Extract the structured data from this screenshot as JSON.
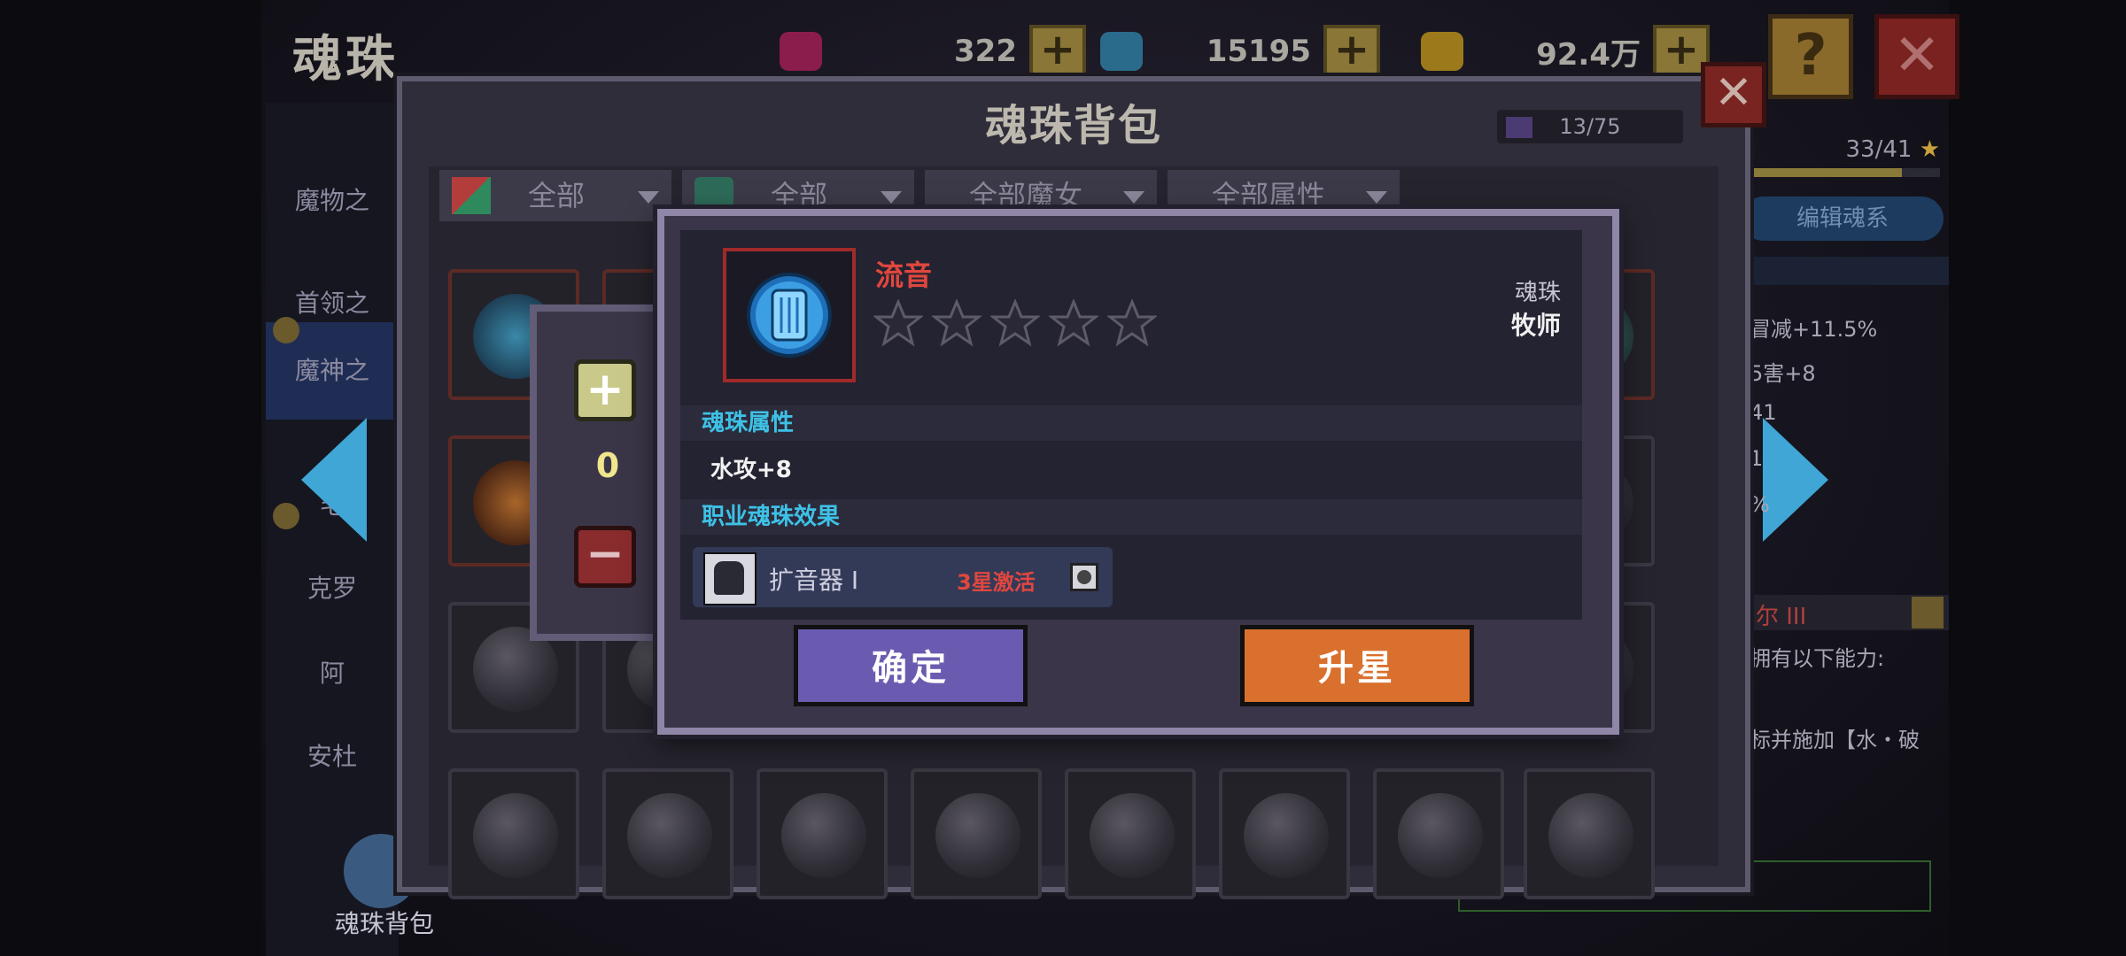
{
  "page_title": "魂珠",
  "currencies": [
    {
      "icon": "red-gem-icon",
      "amount": "322",
      "color": "#8b1d4c"
    },
    {
      "icon": "blue-gem-icon",
      "amount": "15195",
      "color": "#2a6b8c"
    },
    {
      "icon": "gold-coin-icon",
      "amount": "92.4万",
      "color": "#9c7a1c"
    }
  ],
  "sidebar": {
    "items": [
      {
        "label": "魔物之"
      },
      {
        "label": "首领之"
      },
      {
        "label": "魔神之"
      },
      {
        "label": "毛"
      },
      {
        "label": "克罗"
      },
      {
        "label": "阿"
      },
      {
        "label": "安杜"
      }
    ],
    "bottom_label": "魂珠背包"
  },
  "right_panel": {
    "progress": "33/41",
    "edit_button": "编辑魂系",
    "lines": [
      "冒减+11.5%",
      "5害+8",
      "41",
      "1",
      "%"
    ],
    "section_title": "尔 III",
    "desc_1": "拥有以下能力:",
    "desc_2": "标并施加【水・破"
  },
  "bag": {
    "title": "魂珠背包",
    "capacity": "13/75",
    "filters": [
      "全部",
      "全部",
      "全部魔女",
      "全部属性"
    ]
  },
  "quantity_panel": {
    "value": "0"
  },
  "detail": {
    "name": "流音",
    "stars_filled": 0,
    "stars_total": 5,
    "type_label": "魂珠",
    "class_label": "牧师",
    "attr_section_title": "魂珠属性",
    "attr_value": "水攻+8",
    "effect_section_title": "职业魂珠效果",
    "effect_name": "扩音器 I",
    "effect_status": "3星激活",
    "confirm_label": "确定",
    "upgrade_label": "升星"
  },
  "colors": {
    "name_red": "#e0473e",
    "section_cyan": "#3ec1e6",
    "confirm_purple": "#6b5bb0",
    "upgrade_orange": "#d9702e"
  }
}
